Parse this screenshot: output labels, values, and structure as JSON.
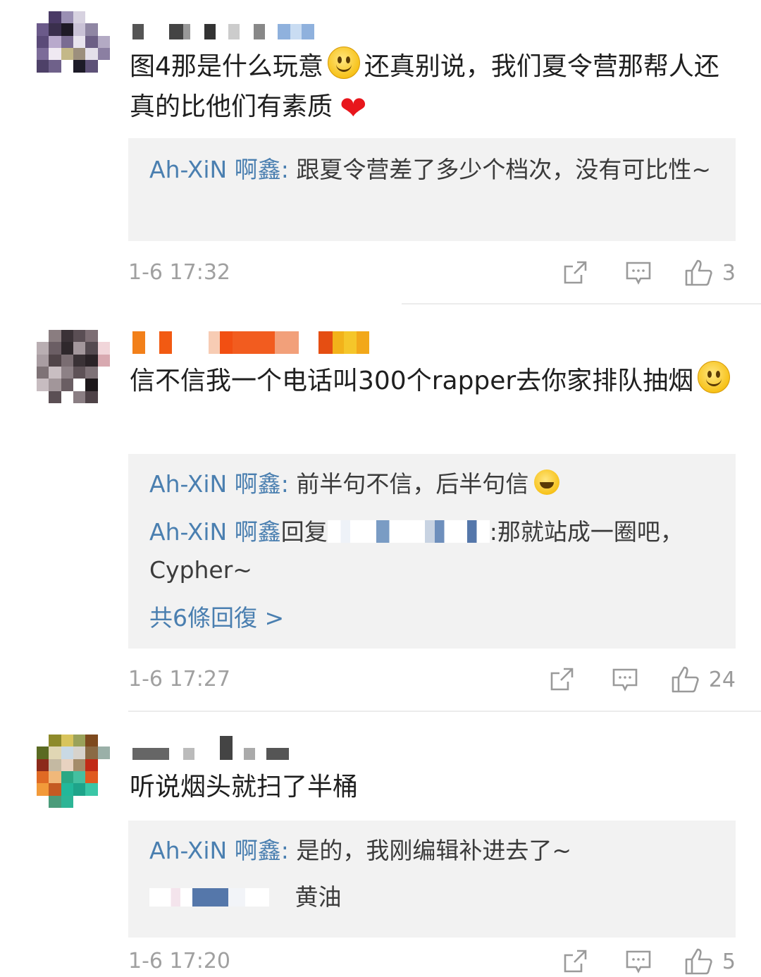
{
  "comments": [
    {
      "text_a": "图4那是什么玩意",
      "text_b": "还真别说，我们夏令营那帮人还真的比他们有素质",
      "replies": [
        {
          "name": "Ah-XiN 啊鑫",
          "sep": ": ",
          "text": "跟夏令营差了多少个档次，没有可比性~"
        }
      ],
      "time": "1-6 17:32",
      "likes": "3"
    },
    {
      "text_a": "信不信我一个电话叫300个rapper去你家排队抽烟",
      "replies": [
        {
          "name": "Ah-XiN 啊鑫",
          "sep": ": ",
          "text": "前半句不信，后半句信"
        },
        {
          "name": "Ah-XiN 啊鑫",
          "sep": "回复",
          "text_tail": ":那就站成一圈吧，Cypher~"
        }
      ],
      "more_replies": "共6條回復 >",
      "time": "1-6 17:27",
      "likes": "24"
    },
    {
      "text_a": "听说烟头就扫了半桶",
      "replies": [
        {
          "name": "Ah-XiN 啊鑫",
          "sep": ": ",
          "text": "是的，我刚编辑补进去了~"
        },
        {
          "text": "黄油"
        }
      ],
      "time": "1-6 17:20",
      "likes": "5"
    }
  ],
  "icons": {
    "share": "share-icon",
    "comment": "comment-icon",
    "like": "thumbs-up-icon"
  },
  "colors": {
    "link": "#4a7fb0",
    "reply_bg": "#f2f2f2",
    "meta": "#a0a0a0"
  }
}
